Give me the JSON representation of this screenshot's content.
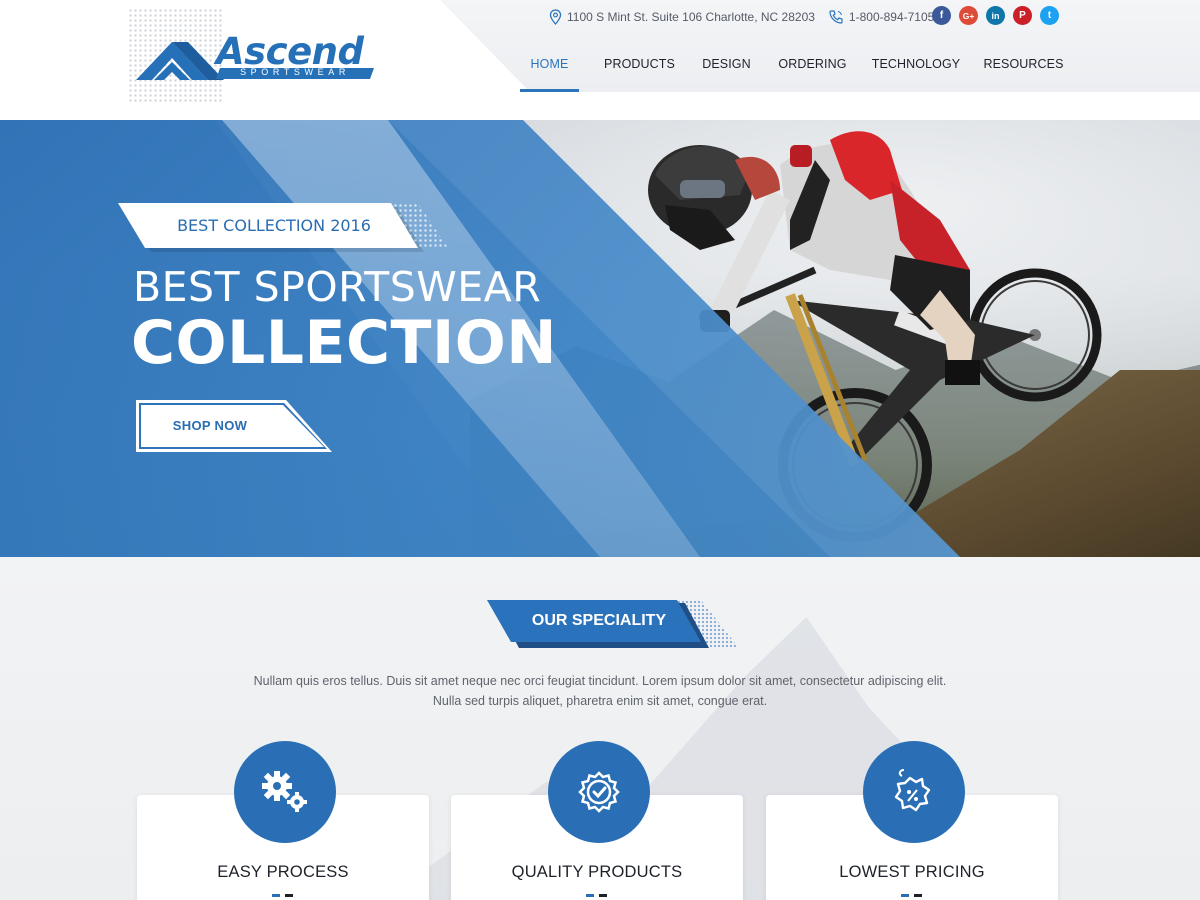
{
  "brand": {
    "name": "Ascend",
    "tagline": "SPORTSWEAR",
    "accent_color": "#2a6fb5",
    "dark_text_color": "#1d2129"
  },
  "contact": {
    "address": "1100 S Mint St. Suite 106 Charlotte, NC 28203",
    "address_icon": "map-pin-icon",
    "phone": "1-800-894-7105",
    "phone_icon": "phone-icon"
  },
  "socials": [
    {
      "name": "facebook",
      "glyph": "f",
      "color": "#3b5998"
    },
    {
      "name": "google-plus",
      "glyph": "G+",
      "color": "#dd4b39"
    },
    {
      "name": "linkedin",
      "glyph": "in",
      "color": "#0e76a8"
    },
    {
      "name": "pinterest",
      "glyph": "P",
      "color": "#cb2027"
    },
    {
      "name": "twitter",
      "glyph": "t",
      "color": "#1da1f2"
    }
  ],
  "nav": {
    "items": [
      {
        "label": "HOME",
        "active": true
      },
      {
        "label": "PRODUCTS",
        "active": false
      },
      {
        "label": "DESIGN",
        "active": false
      },
      {
        "label": "ORDERING",
        "active": false
      },
      {
        "label": "TECHNOLOGY",
        "active": false
      },
      {
        "label": "RESOURCES",
        "active": false
      }
    ]
  },
  "hero": {
    "tag": "BEST COLLECTION 2016",
    "title_line1": "BEST SPORTSWEAR",
    "title_line2": "COLLECTION",
    "cta": "SHOP NOW"
  },
  "speciality": {
    "badge": "OUR SPECIALITY",
    "description_line1": "Nullam quis eros tellus. Duis sit amet neque nec orci feugiat tincidunt. Lorem ipsum dolor sit amet, consectetur adipiscing elit.",
    "description_line2": "Nulla sed turpis aliquet, pharetra enim sit amet, congue erat.",
    "cards": [
      {
        "title": "EASY PROCESS",
        "icon": "gears-icon"
      },
      {
        "title": "QUALITY PRODUCTS",
        "icon": "quality-badge-icon"
      },
      {
        "title": "LOWEST PRICING",
        "icon": "discount-tag-icon"
      }
    ]
  }
}
